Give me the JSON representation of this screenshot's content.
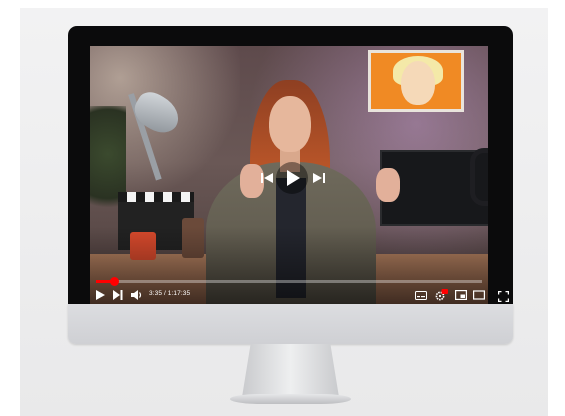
{
  "player": {
    "time_current": "3:35",
    "time_separator": " / ",
    "time_total": "1:17:35",
    "progress": 0.046,
    "progress_color": "#ff0000"
  },
  "controls": {
    "left": [
      {
        "name": "play-icon"
      },
      {
        "name": "next-icon"
      },
      {
        "name": "volume-icon"
      }
    ],
    "right": [
      {
        "name": "subtitles-icon"
      },
      {
        "name": "settings-icon",
        "badge_color": "#ff0000"
      },
      {
        "name": "miniplayer-icon"
      },
      {
        "name": "theater-mode-icon"
      },
      {
        "name": "fullscreen-icon"
      }
    ],
    "center": [
      {
        "name": "previous-icon"
      },
      {
        "name": "play-icon"
      },
      {
        "name": "next-icon"
      }
    ]
  },
  "colors": {
    "bezel": "#0b0b0c",
    "chin": "#d4d5d8",
    "accent": "#ff0000"
  }
}
